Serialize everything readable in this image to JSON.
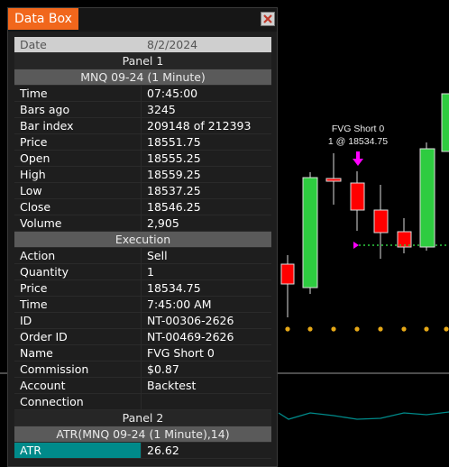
{
  "chart": {
    "annotation_title": "FVG Short 0",
    "annotation_detail": "1 @ 18534.75"
  },
  "databox": {
    "title": "Data Box",
    "date_label": "Date",
    "date_value": "8/2/2024",
    "panel1_label": "Panel 1",
    "instrument": "MNQ 09-24 (1 Minute)",
    "bar_rows": [
      {
        "label": "Time",
        "value": "07:45:00"
      },
      {
        "label": "Bars ago",
        "value": "3245"
      },
      {
        "label": "Bar index",
        "value": "209148 of 212393"
      },
      {
        "label": "Price",
        "value": "18551.75"
      },
      {
        "label": "Open",
        "value": "18555.25"
      },
      {
        "label": "High",
        "value": "18559.25"
      },
      {
        "label": "Low",
        "value": "18537.25"
      },
      {
        "label": "Close",
        "value": "18546.25"
      },
      {
        "label": "Volume",
        "value": "2,905"
      }
    ],
    "execution_label": "Execution",
    "execution_rows": [
      {
        "label": "Action",
        "value": "Sell"
      },
      {
        "label": "Quantity",
        "value": "1"
      },
      {
        "label": "Price",
        "value": "18534.75"
      },
      {
        "label": "Time",
        "value": "7:45:00 AM"
      },
      {
        "label": "ID",
        "value": "NT-00306-2626"
      },
      {
        "label": "Order ID",
        "value": "NT-00469-2626"
      },
      {
        "label": "Name",
        "value": "FVG Short 0"
      },
      {
        "label": "Commission",
        "value": "$0.87"
      },
      {
        "label": "Account",
        "value": "Backtest"
      },
      {
        "label": "Connection",
        "value": ""
      }
    ],
    "panel2_label": "Panel 2",
    "indicator": "ATR(MNQ 09-24 (1 Minute),14)",
    "atr_label": "ATR",
    "atr_value": "26.62"
  },
  "icons": {
    "close": "close-x-icon",
    "trade_marker": "arrow-down-icon"
  },
  "colors": {
    "title_tab": "#f1671c",
    "bull_candle": "#2ecc40",
    "bear_candle": "#ff0000",
    "marker": "#ff00ff",
    "dots": "#e6a817",
    "atr_line": "#008a8a"
  }
}
